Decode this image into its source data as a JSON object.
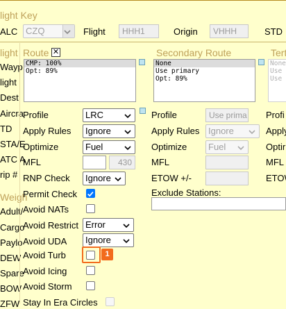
{
  "header": {
    "section_title": "light Key",
    "alc_label": "ALC",
    "alc_value": "CZQ",
    "flight_label": "Flight",
    "flight_value": "HHH1",
    "origin_label": "Origin",
    "origin_value": "VHHH",
    "std_label": "STD"
  },
  "left_strip": {
    "flight_section": "light",
    "labels": [
      "Wayp",
      "light",
      "Dest",
      "Aircra",
      "TD",
      "STA/E",
      "ATC A",
      "rip #"
    ],
    "weight_section": "Weigh",
    "weight_labels": [
      "Adult/",
      "Cargo",
      "Paylo",
      "DEW",
      "Spare",
      "BOW",
      "ZFW"
    ]
  },
  "route": {
    "title": "Route",
    "close_symbol": "✕",
    "options": [
      "CMP: 100%",
      "Opt: 89%"
    ],
    "profile_label": "Profile",
    "profile_value": "LRC",
    "apply_rules_label": "Apply Rules",
    "apply_rules_value": "Ignore",
    "optimize_label": "Optimize",
    "optimize_value": "Fuel",
    "mfl_label": "MFL",
    "mfl_value": "",
    "mfl_readonly": "430",
    "rnp_label": "RNP Check",
    "rnp_value": "Ignore",
    "permit_label": "Permit Check",
    "avoid_nats_label": "Avoid NATs",
    "avoid_restrict_label": "Avoid Restrict",
    "avoid_restrict_value": "Error",
    "avoid_uda_label": "Avoid UDA",
    "avoid_uda_value": "Ignore",
    "avoid_turb_label": "Avoid Turb",
    "avoid_turb_badge": "1",
    "avoid_icing_label": "Avoid Icing",
    "avoid_storm_label": "Avoid Storm",
    "stay_era_label": "Stay In Era Circles"
  },
  "secondary": {
    "title": "Secondary Route",
    "options": [
      "None",
      "Use primary",
      "Opt: 89%"
    ],
    "profile_label": "Profile",
    "profile_value": "Use prima",
    "apply_rules_label": "Apply Rules",
    "apply_rules_value": "Ignore",
    "optimize_label": "Optimize",
    "optimize_value": "Fuel",
    "mfl_label": "MFL",
    "etow_label": "ETOW +/-",
    "exclude_label": "Exclude Stations:"
  },
  "tertiary": {
    "title": "Tert",
    "options": [
      "None",
      "Use",
      "Use"
    ],
    "profile_label": "Profi",
    "apply_label": "Apply",
    "optimize_label": "Optir",
    "mfl_label": "MFL",
    "etow_label": "ETOW"
  },
  "colors": {
    "background": "#ffffcc",
    "section_title": "#bfa15a",
    "checkbox_checked": "#0075ff",
    "highlight": "#f26b1d"
  }
}
